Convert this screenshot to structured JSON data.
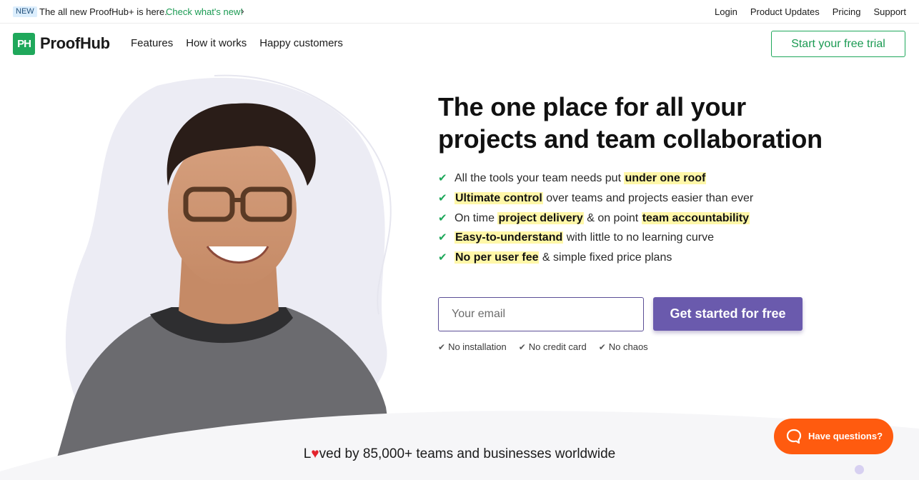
{
  "announcement": {
    "badge": "NEW",
    "text": "The all new ProofHub+ is here.",
    "link": "Check what's new!"
  },
  "top_links": [
    "Login",
    "Product Updates",
    "Pricing",
    "Support"
  ],
  "header": {
    "logo_mark": "PH",
    "logo_text": "ProofHub",
    "nav": [
      "Features",
      "How it works",
      "Happy customers"
    ],
    "trial_button": "Start your free trial"
  },
  "hero": {
    "headline_line1": "The one place for all your",
    "headline_line2": "projects and team collaboration",
    "features": [
      {
        "parts": [
          {
            "t": "All the tools your team needs put ",
            "hl": false
          },
          {
            "t": "under one roof",
            "hl": true
          }
        ]
      },
      {
        "parts": [
          {
            "t": "Ultimate control",
            "hl": true
          },
          {
            "t": " over teams and projects easier than ever",
            "hl": false
          }
        ]
      },
      {
        "parts": [
          {
            "t": "On time ",
            "hl": false
          },
          {
            "t": "project delivery",
            "hl": true
          },
          {
            "t": " & on point ",
            "hl": false
          },
          {
            "t": "team accountability",
            "hl": true
          }
        ]
      },
      {
        "parts": [
          {
            "t": "Easy-to-understand",
            "hl": true
          },
          {
            "t": " with little to no learning curve",
            "hl": false
          }
        ]
      },
      {
        "parts": [
          {
            "t": "No per user fee",
            "hl": true
          },
          {
            "t": " & simple fixed price plans",
            "hl": false
          }
        ]
      }
    ],
    "email_placeholder": "Your email",
    "cta": "Get started for free",
    "perks": [
      "No installation",
      "No credit card",
      "No chaos"
    ]
  },
  "loved": {
    "prefix": "L",
    "suffix": "ved by 85,000+ teams and businesses worldwide"
  },
  "help": {
    "label": "Have questions?"
  },
  "colors": {
    "brand_green": "#1fa85b",
    "cta_purple": "#6a5aad",
    "highlight_yellow": "#fff7a8",
    "help_orange": "#ff5b0f"
  }
}
